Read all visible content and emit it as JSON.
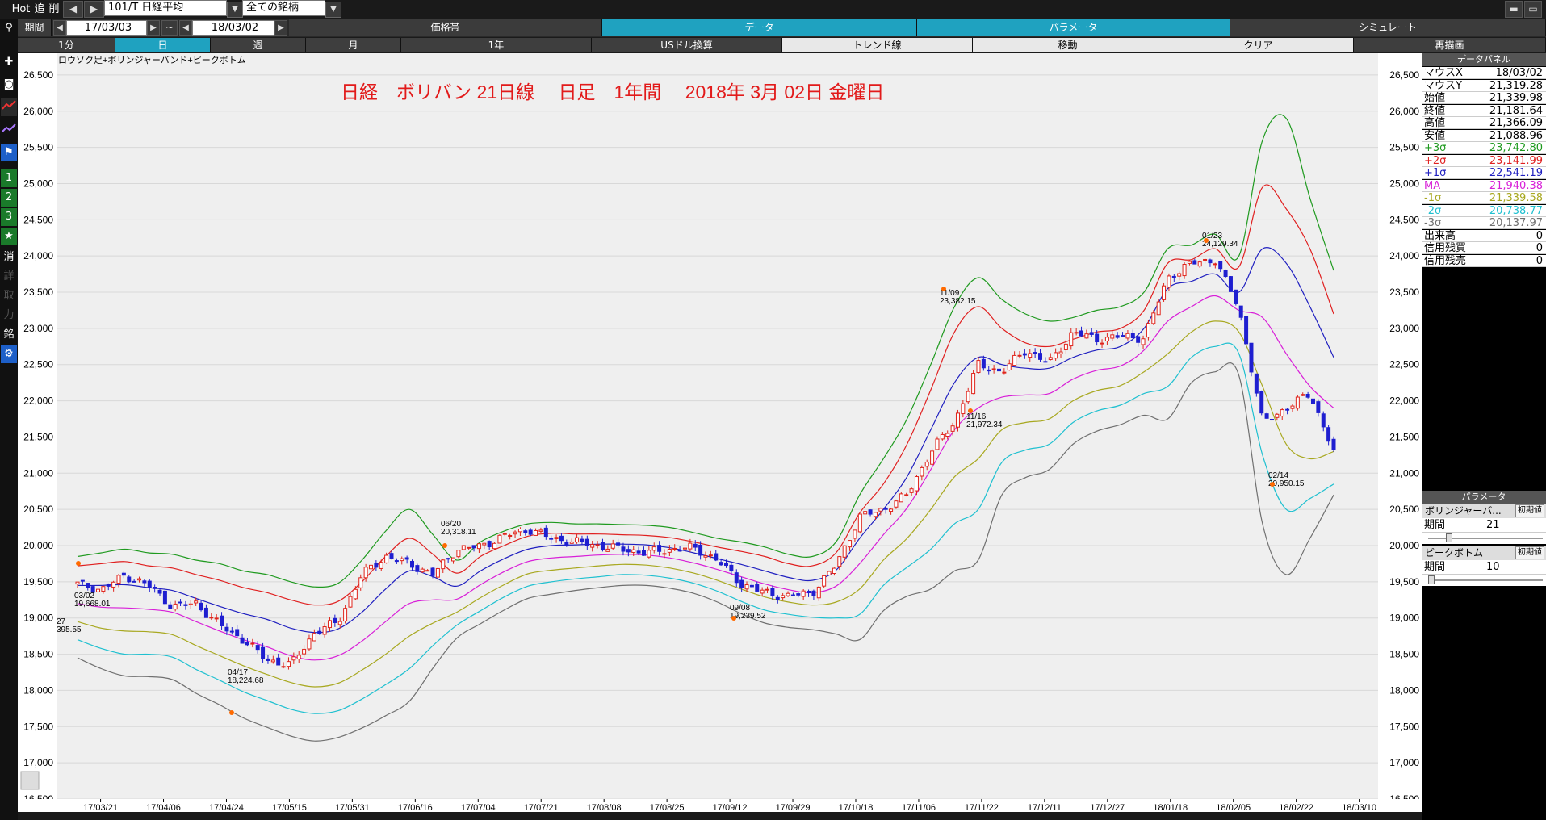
{
  "topbar": {
    "hot": "Hot",
    "tsui": "追",
    "sakujo": "削",
    "prev_icon": "triangle-left-icon",
    "next_icon": "triangle-right-icon",
    "symbol": "101/T 日経平均",
    "universe": "全ての銘柄"
  },
  "row2": {
    "period_label": "期間",
    "date_from": "17/03/03",
    "tilde": "~",
    "date_to": "18/03/02",
    "tabs": [
      "価格帯",
      "データ",
      "パラメータ",
      "シミュレート"
    ]
  },
  "row3": {
    "tabs": [
      "1分",
      "日",
      "週",
      "月",
      "1年",
      "USドル換算",
      "トレンド線",
      "移動",
      "クリア",
      "再描画"
    ]
  },
  "left_toolbar": {
    "icons": [
      "search-icon",
      "plus-icon",
      "camera-icon",
      "line-chart-icon",
      "chart-icon",
      "flag-icon"
    ],
    "buttons": [
      "1",
      "2",
      "3",
      "★",
      "消",
      "詳",
      "取",
      "力",
      "銘",
      "⚙"
    ]
  },
  "colors": {
    "candle_up": "#e0241b",
    "candle_down": "#1f1fd0",
    "plus3": "#1f9a1f",
    "plus2": "#e02020",
    "plus1": "#2020c0",
    "ma": "#d81fd8",
    "minus1": "#a8a820",
    "minus2": "#1fc0d0",
    "minus3": "#707070",
    "cyan": "#1fa2c0"
  },
  "chart_data": {
    "type": "line",
    "subtitle": "ロウソク足+ボリンジャーバンド+ピークボトム",
    "title": "日経　ボリバン 21日線　 日足　1年間　 2018年 3月 02日 金曜日",
    "ylim": [
      16500,
      26800
    ],
    "yticks": [
      "26,500",
      "26,000",
      "25,500",
      "25,000",
      "24,500",
      "24,000",
      "23,500",
      "23,000",
      "22,500",
      "22,000",
      "21,500",
      "21,000",
      "20,500",
      "20,000",
      "19,500",
      "19,000",
      "18,500",
      "18,000",
      "17,500",
      "17,000",
      "16,500"
    ],
    "xticks": [
      "17/03/21",
      "17/04/06",
      "17/04/24",
      "17/05/15",
      "17/05/31",
      "17/06/16",
      "17/07/04",
      "17/07/21",
      "17/08/08",
      "17/08/25",
      "17/09/12",
      "17/09/29",
      "17/10/18",
      "17/11/06",
      "17/11/22",
      "17/12/11",
      "17/12/27",
      "18/01/18",
      "18/02/05",
      "18/02/22",
      "18/03/10"
    ],
    "series": [
      {
        "key": "plus3",
        "values": [
          19850,
          19900,
          19950,
          19900,
          19880,
          19800,
          19750,
          19650,
          19600,
          19500,
          19430,
          19480,
          19800,
          20200,
          20500,
          20150,
          19800,
          20050,
          20200,
          20300,
          20320,
          20300,
          20300,
          20290,
          20280,
          20250,
          20180,
          20100,
          20050,
          19980,
          19880,
          19850,
          20050,
          20700,
          21200,
          21750,
          22500,
          23300,
          23700,
          23400,
          23200,
          23100,
          23150,
          23250,
          23300,
          23500,
          24100,
          24150,
          24300,
          24000,
          25600,
          25900,
          24800,
          23800
        ]
      },
      {
        "key": "plus2",
        "values": [
          19720,
          19750,
          19780,
          19720,
          19690,
          19600,
          19520,
          19420,
          19350,
          19250,
          19180,
          19230,
          19500,
          19850,
          20100,
          19880,
          19620,
          19850,
          20000,
          20130,
          20170,
          20160,
          20160,
          20150,
          20140,
          20110,
          20050,
          19980,
          19920,
          19850,
          19750,
          19720,
          19900,
          20450,
          20850,
          21400,
          22150,
          22950,
          23300,
          23000,
          22800,
          22750,
          22850,
          22950,
          23000,
          23250,
          23900,
          23950,
          24100,
          23850,
          24950,
          24650,
          24100,
          23200
        ]
      },
      {
        "key": "plus1",
        "values": [
          19450,
          19450,
          19460,
          19420,
          19380,
          19270,
          19160,
          19060,
          18980,
          18860,
          18800,
          18850,
          19080,
          19400,
          19650,
          19570,
          19440,
          19650,
          19820,
          19950,
          20000,
          20010,
          20020,
          20020,
          20010,
          19970,
          19900,
          19820,
          19740,
          19650,
          19560,
          19520,
          19660,
          20100,
          20500,
          20950,
          21600,
          22250,
          22600,
          22500,
          22450,
          22450,
          22600,
          22700,
          22750,
          23000,
          23550,
          23650,
          23750,
          23500,
          24100,
          23900,
          23300,
          22600
        ]
      },
      {
        "key": "ma",
        "values": [
          19200,
          19150,
          19140,
          19120,
          19080,
          18950,
          18820,
          18700,
          18600,
          18480,
          18420,
          18480,
          18680,
          18950,
          19200,
          19250,
          19260,
          19460,
          19640,
          19780,
          19830,
          19850,
          19870,
          19880,
          19870,
          19830,
          19760,
          19670,
          19570,
          19470,
          19390,
          19350,
          19440,
          19750,
          20150,
          20520,
          21050,
          21600,
          21900,
          22050,
          22080,
          22100,
          22300,
          22420,
          22480,
          22700,
          23100,
          23300,
          23450,
          23250,
          23150,
          22650,
          22200,
          21900
        ]
      },
      {
        "key": "minus1",
        "values": [
          18950,
          18860,
          18820,
          18810,
          18770,
          18620,
          18480,
          18340,
          18220,
          18110,
          18050,
          18100,
          18280,
          18500,
          18750,
          18930,
          19080,
          19280,
          19460,
          19610,
          19660,
          19690,
          19720,
          19740,
          19730,
          19690,
          19620,
          19520,
          19400,
          19290,
          19220,
          19180,
          19220,
          19400,
          19800,
          20100,
          20500,
          20950,
          21200,
          21600,
          21700,
          21750,
          22000,
          22140,
          22210,
          22400,
          22650,
          22950,
          23100,
          22950,
          22200,
          21400,
          21200,
          21300
        ]
      },
      {
        "key": "minus2",
        "values": [
          18700,
          18580,
          18500,
          18500,
          18460,
          18290,
          18140,
          17980,
          17860,
          17740,
          17680,
          17720,
          17880,
          18080,
          18300,
          18620,
          18900,
          19100,
          19290,
          19440,
          19500,
          19540,
          19570,
          19600,
          19590,
          19550,
          19480,
          19370,
          19230,
          19110,
          19050,
          19010,
          19000,
          19050,
          19450,
          19700,
          19950,
          20300,
          20500,
          21150,
          21320,
          21400,
          21700,
          21860,
          21940,
          22100,
          22200,
          22600,
          22750,
          22650,
          21250,
          20500,
          20650,
          20850
        ]
      },
      {
        "key": "minus3",
        "values": [
          18450,
          18300,
          18200,
          18190,
          18150,
          17960,
          17800,
          17620,
          17490,
          17370,
          17300,
          17350,
          17480,
          17650,
          17850,
          18310,
          18720,
          18920,
          19110,
          19270,
          19330,
          19380,
          19420,
          19450,
          19450,
          19410,
          19340,
          19220,
          19060,
          18930,
          18870,
          18840,
          18780,
          18700,
          19100,
          19300,
          19400,
          19650,
          19800,
          20700,
          20940,
          21050,
          21400,
          21580,
          21670,
          21800,
          21750,
          22250,
          22400,
          22350,
          20300,
          19600,
          20100,
          20700
        ]
      }
    ],
    "close": [
      19470,
      19390,
      19590,
      19450,
      19160,
      19200,
      18900,
      18700,
      18420,
      18350,
      18800,
      18950,
      19600,
      19850,
      19750,
      19600,
      19950,
      19990,
      20130,
      20230,
      20100,
      20050,
      20000,
      19950,
      19900,
      19950,
      19970,
      19800,
      19470,
      19350,
      19300,
      19350,
      19730,
      20400,
      20500,
      20700,
      21300,
      21700,
      22500,
      22400,
      22700,
      22520,
      22950,
      22850,
      22890,
      22870,
      23700,
      23900,
      23950,
      23280,
      21700,
      21900,
      22100,
      21300
    ],
    "peaks": [
      {
        "label": "03/02",
        "value": "19,668.01"
      },
      {
        "label": "04/17",
        "value": "18,224.68"
      },
      {
        "label": "06/20",
        "value": "20,318.11"
      },
      {
        "label": "09/08",
        "value": "19,239.52"
      },
      {
        "label": "11/09",
        "value": "23,382.15"
      },
      {
        "label": "11/16",
        "value": "21,972.34"
      },
      {
        "label": "01/23",
        "value": "24,129.34"
      },
      {
        "label": "02/14",
        "value": "20,950.15"
      },
      {
        "label": "27",
        "value": "395.55"
      }
    ]
  },
  "panel": {
    "header": "データパネル",
    "rows": [
      {
        "k": "マウスX",
        "v": "18/03/02"
      },
      {
        "k": "マウスY",
        "v": "21,319.28"
      },
      {
        "k": "始値",
        "v": "21,339.98"
      },
      {
        "k": "終値",
        "v": "21,181.64"
      },
      {
        "k": "高値",
        "v": "21,366.09"
      },
      {
        "k": "安値",
        "v": "21,088.96"
      },
      {
        "k": "+3σ",
        "v": "23,742.80"
      },
      {
        "k": "+2σ",
        "v": "23,141.99"
      },
      {
        "k": "+1σ",
        "v": "22,541.19"
      },
      {
        "k": "MA",
        "v": "21,940.38"
      },
      {
        "k": "-1σ",
        "v": "21,339.58"
      },
      {
        "k": "-2σ",
        "v": "20,738.77"
      },
      {
        "k": "-3σ",
        "v": "20,137.97"
      },
      {
        "k": "出来高",
        "v": "0"
      },
      {
        "k": "信用残買",
        "v": "0"
      },
      {
        "k": "信用残売",
        "v": "0"
      }
    ],
    "param_header": "パラメータ",
    "bb_name": "ボリンジャーバ...",
    "bb_init": "初期値",
    "bb_period_label": "期間",
    "bb_period": "21",
    "pb_name": "ピークボトム",
    "pb_init": "初期値",
    "pb_period_label": "期間",
    "pb_period": "10"
  }
}
